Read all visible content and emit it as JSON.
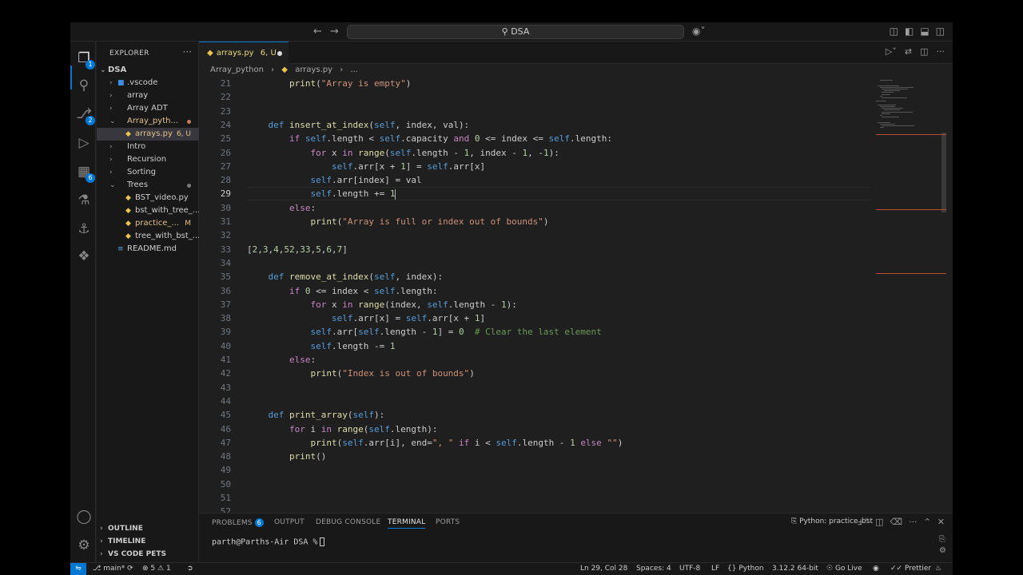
{
  "title": {
    "search": "DSA"
  },
  "activity": {
    "explorer_badge": "1",
    "scm_badge": "2",
    "ext_badge": "6"
  },
  "sidebar": {
    "header": "EXPLORER",
    "root": "DSA",
    "items": [
      {
        "label": ".vscode"
      },
      {
        "label": "array"
      },
      {
        "label": "Array ADT"
      },
      {
        "label": "Array_pyth..."
      },
      {
        "label": "arrays.py",
        "status": "6, U"
      },
      {
        "label": "Intro"
      },
      {
        "label": "Recursion"
      },
      {
        "label": "Sorting"
      },
      {
        "label": "Trees"
      },
      {
        "label": "BST_video.py"
      },
      {
        "label": "bst_with_tree_..."
      },
      {
        "label": "practice_...",
        "status": "M"
      },
      {
        "label": "tree_with_bst_..."
      },
      {
        "label": "README.md"
      }
    ],
    "outline": "OUTLINE",
    "timeline": "TIMELINE",
    "pets": "VS CODE PETS"
  },
  "editor": {
    "tab_label": "arrays.py",
    "tab_status": "6, U",
    "breadcrumb": [
      "Array_python",
      "arrays.py",
      "..."
    ],
    "lines": [
      {
        "n": "21",
        "t": "        print(\"Array is empty\")"
      },
      {
        "n": "22",
        "t": ""
      },
      {
        "n": "23",
        "t": ""
      },
      {
        "n": "24",
        "t": "    def insert_at_index(self, index, val):"
      },
      {
        "n": "25",
        "t": "        if self.length < self.capacity and 0 <= index <= self.length:"
      },
      {
        "n": "26",
        "t": "            for x in range(self.length - 1, index - 1, -1):"
      },
      {
        "n": "27",
        "t": "                self.arr[x + 1] = self.arr[x]"
      },
      {
        "n": "28",
        "t": "            self.arr[index] = val"
      },
      {
        "n": "29",
        "t": "            self.length += 1"
      },
      {
        "n": "30",
        "t": "        else:"
      },
      {
        "n": "31",
        "t": "            print(\"Array is full or index out of bounds\")"
      },
      {
        "n": "32",
        "t": ""
      },
      {
        "n": "33",
        "t": "[2,3,4,52,33,5,6,7]"
      },
      {
        "n": "34",
        "t": ""
      },
      {
        "n": "35",
        "t": "    def remove_at_index(self, index):"
      },
      {
        "n": "36",
        "t": "        if 0 <= index < self.length:"
      },
      {
        "n": "37",
        "t": "            for x in range(index, self.length - 1):"
      },
      {
        "n": "38",
        "t": "                self.arr[x] = self.arr[x + 1]"
      },
      {
        "n": "39",
        "t": "            self.arr[self.length - 1] = 0  # Clear the last element"
      },
      {
        "n": "40",
        "t": "            self.length -= 1"
      },
      {
        "n": "41",
        "t": "        else:"
      },
      {
        "n": "42",
        "t": "            print(\"Index is out of bounds\")"
      },
      {
        "n": "43",
        "t": ""
      },
      {
        "n": "44",
        "t": ""
      },
      {
        "n": "45",
        "t": "    def print_array(self):"
      },
      {
        "n": "46",
        "t": "        for i in range(self.length):"
      },
      {
        "n": "47",
        "t": "            print(self.arr[i], end=\", \" if i < self.length - 1 else \"\")"
      },
      {
        "n": "48",
        "t": "        print()"
      },
      {
        "n": "49",
        "t": ""
      },
      {
        "n": "50",
        "t": ""
      },
      {
        "n": "51",
        "t": ""
      },
      {
        "n": "52",
        "t": ""
      }
    ]
  },
  "panel": {
    "tabs": [
      "PROBLEMS",
      "OUTPUT",
      "DEBUG CONSOLE",
      "TERMINAL",
      "PORTS"
    ],
    "problems_badge": "6",
    "terminal_name": "Python: practice_bst",
    "prompt": "parth@Parths-Air DSA %"
  },
  "status": {
    "branch": "main*",
    "errors": "5",
    "warnings": "1",
    "position": "Ln 29, Col 28",
    "spaces": "Spaces: 4",
    "encoding": "UTF-8",
    "eol": "LF",
    "language": "Python",
    "interpreter": "3.12.2 64-bit",
    "golive": "Go Live",
    "prettier": "Prettier"
  }
}
